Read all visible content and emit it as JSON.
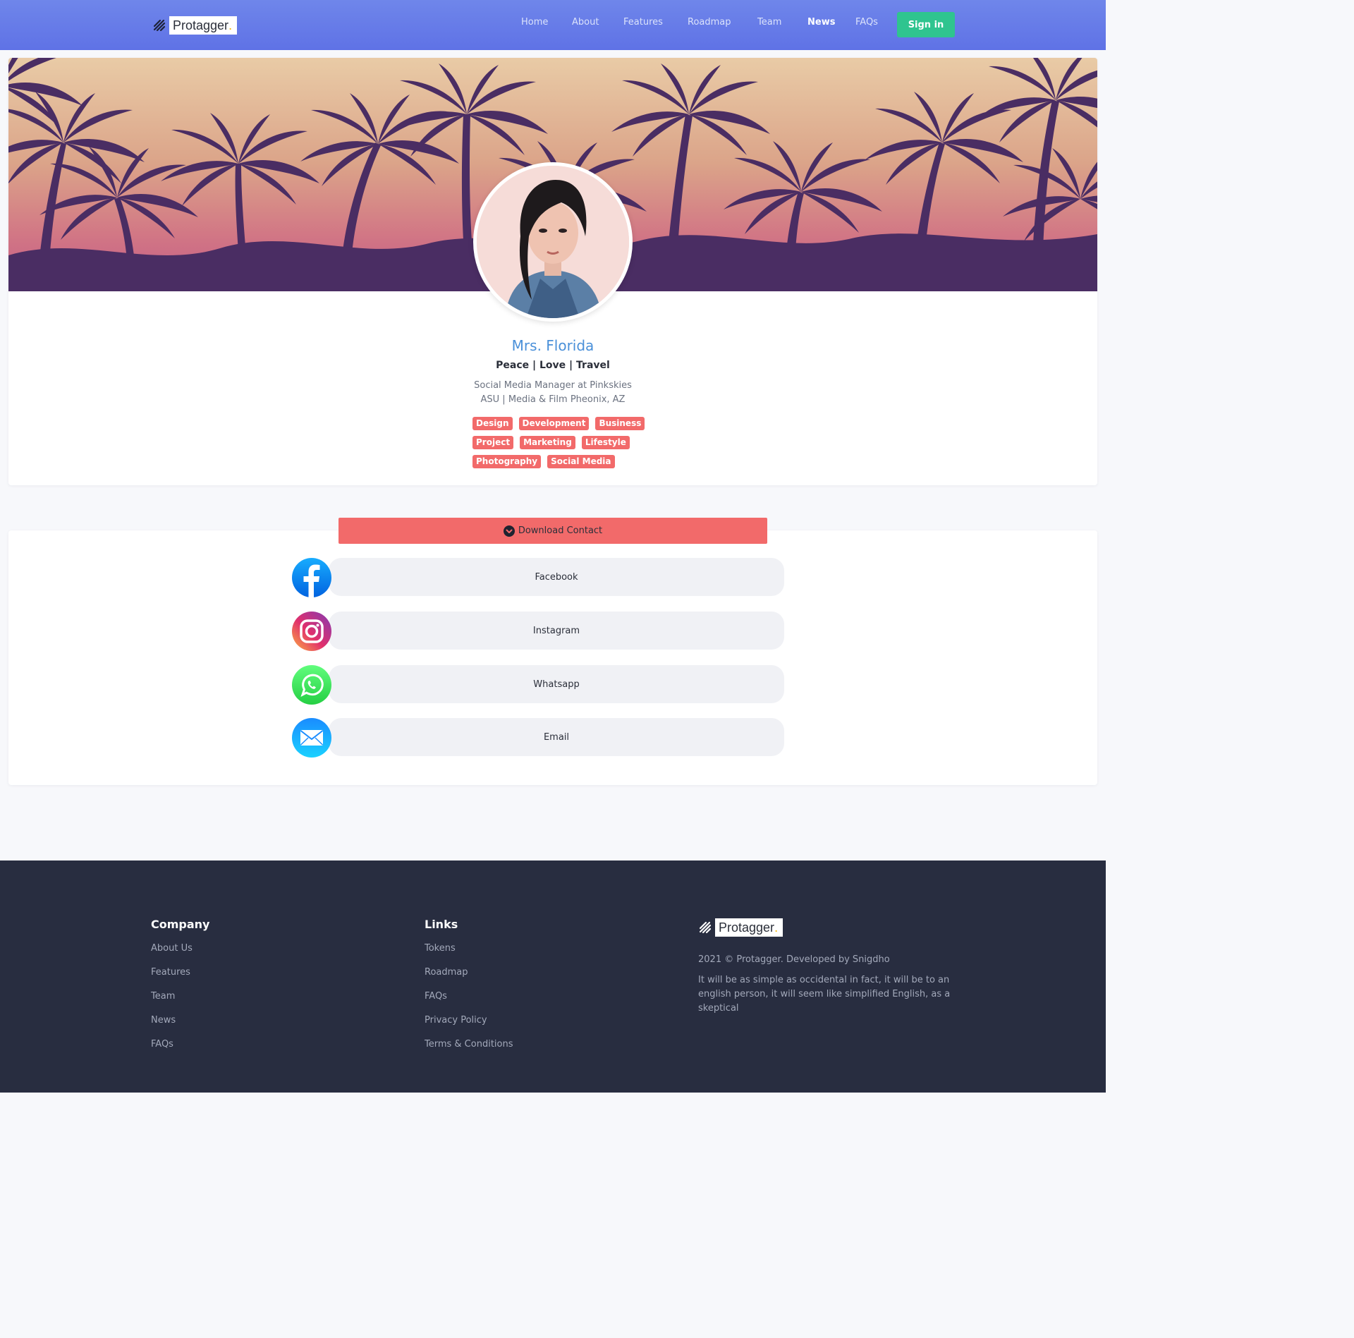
{
  "brand": {
    "name": "Protagger",
    "dot": "."
  },
  "nav": {
    "links": [
      "Home",
      "About",
      "Features",
      "Roadmap",
      "Team",
      "News",
      "FAQs"
    ],
    "active": "News",
    "signin_label": "Sign in"
  },
  "profile": {
    "name": "Mrs. Florida",
    "tagline": "Peace | Love | Travel",
    "bio_line1": "Social Media Manager at Pinkskies",
    "bio_line2": "ASU | Media & Film Pheonix, AZ",
    "tags": [
      "Design",
      "Development",
      "Business",
      "Project",
      "Marketing",
      "Lifestyle",
      "Photography",
      "Social Media"
    ]
  },
  "contact": {
    "download_label": "Download Contact",
    "links": [
      {
        "label": "Facebook",
        "icon": "facebook-icon"
      },
      {
        "label": "Instagram",
        "icon": "instagram-icon"
      },
      {
        "label": "Whatsapp",
        "icon": "whatsapp-icon"
      },
      {
        "label": "Email",
        "icon": "email-icon"
      }
    ]
  },
  "footer": {
    "company": {
      "title": "Company",
      "links": [
        "About Us",
        "Features",
        "Team",
        "News",
        "FAQs"
      ]
    },
    "links": {
      "title": "Links",
      "links": [
        "Tokens",
        "Roadmap",
        "FAQs",
        "Privacy Policy",
        "Terms & Conditions"
      ]
    },
    "copyright": "2021 © Protagger. Developed by Snigdho",
    "description": "It will be as simple as occidental in fact, it will be to an english person, it will seem like simplified English, as a skeptical"
  },
  "colors": {
    "nav_gradient_top": "#6f86ea",
    "accent_green": "#2fc48f",
    "accent_red": "#f26a6a",
    "name_blue": "#4a90d9",
    "footer_bg": "#282d40"
  }
}
